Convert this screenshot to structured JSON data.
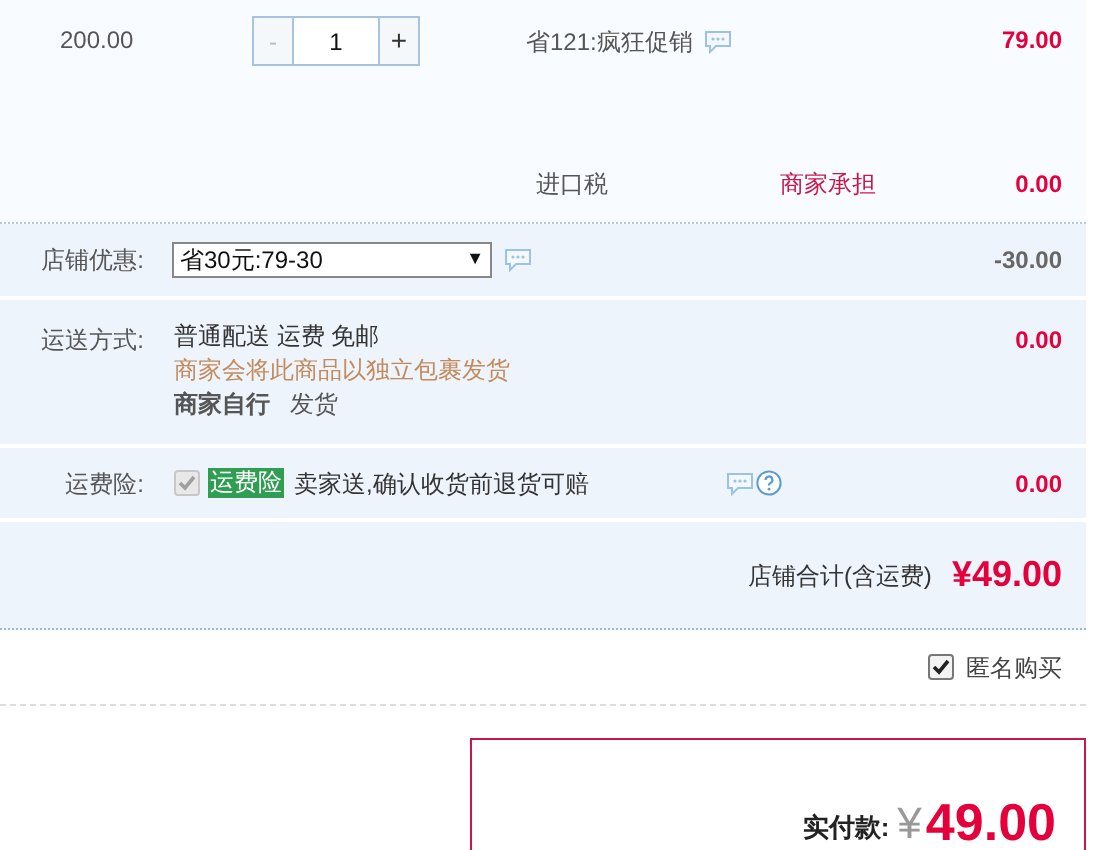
{
  "item": {
    "price": "200.00",
    "stepper": {
      "minus": {
        "label": "-",
        "disabled": true
      },
      "quantity": "1",
      "plus": {
        "label": "+",
        "disabled": false
      }
    },
    "promo": "省121:疯狂促销",
    "amount": "79.00"
  },
  "tax": {
    "label": "进口税",
    "bearer": "商家承担",
    "amount": "0.00"
  },
  "store_discount": {
    "label": "店铺优惠:",
    "select": "省30元:79-30",
    "caret": "▼",
    "amount": "-30.00"
  },
  "shipping": {
    "label": "运送方式:",
    "method": "普通配送",
    "fee_label": "运费",
    "fee_value": "免邮",
    "note": "商家会将此商品以独立包裹发货",
    "carrier": "商家自行",
    "dispatch": "发货",
    "amount": "0.00"
  },
  "insurance": {
    "label": "运费险:",
    "checked": true,
    "disabled": true,
    "tag": "运费险",
    "description": "卖家送,确认收货前退货可赔",
    "amount": "0.00"
  },
  "store_total": {
    "label": "店铺合计(含运费)",
    "amount": "¥49.00"
  },
  "anonymous": {
    "label": "匿名购买",
    "checked": true
  },
  "payment": {
    "label": "实付款:",
    "currency": "¥",
    "amount": "49.00"
  }
}
